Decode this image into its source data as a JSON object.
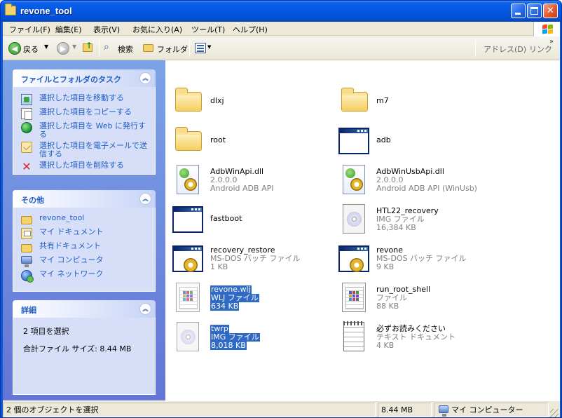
{
  "window": {
    "title": "revone_tool"
  },
  "menu": [
    "ファイル(F)",
    "編集(E)",
    "表示(V)",
    "お気に入り(A)",
    "ツール(T)",
    "ヘルプ(H)"
  ],
  "toolbar": {
    "back_label": "戻る",
    "search_label": "検索",
    "folders_label": "フォルダ",
    "address_label": "アドレス(D)",
    "links_label": "リンク",
    "more": "»"
  },
  "task_pane": {
    "file_tasks": {
      "title": "ファイルとフォルダのタスク",
      "items": [
        "選択した項目を移動する",
        "選択した項目をコピーする",
        "選択した項目を Web に発行する",
        "選択した項目を電子メールで送信する",
        "選択した項目を削除する"
      ]
    },
    "other_places": {
      "title": "その他",
      "items": [
        "revone_tool",
        "マイ ドキュメント",
        "共有ドキュメント",
        "マイ コンピュータ",
        "マイ ネットワーク"
      ]
    },
    "details": {
      "title": "詳細",
      "selected_text": "2 項目を選択",
      "total_size_text": "合計ファイル サイズ: 8.44 MB"
    }
  },
  "files": [
    {
      "name": "dlxj",
      "type": "folder"
    },
    {
      "name": "m7",
      "type": "folder"
    },
    {
      "name": "root",
      "type": "folder"
    },
    {
      "name": "adb",
      "type": "app"
    },
    {
      "name": "AdbWinApi.dll",
      "line2": "2.0.0.0",
      "line3": "Android ADB API",
      "type": "dll"
    },
    {
      "name": "AdbWinUsbApi.dll",
      "line2": "2.0.0.0",
      "line3": "Android ADB API (WinUsb)",
      "type": "dll"
    },
    {
      "name": "fastboot",
      "type": "app"
    },
    {
      "name": "HTL22_recovery",
      "line2": "IMG ファイル",
      "line3": "16,384 KB",
      "type": "disc"
    },
    {
      "name": "recovery_restore",
      "line2": "MS-DOS バッチ ファイル",
      "line3": "1 KB",
      "type": "batch"
    },
    {
      "name": "revone",
      "line2": "MS-DOS バッチ ファイル",
      "line3": "9 KB",
      "type": "batch"
    },
    {
      "name": "revone.wlj",
      "line2": "WLJ ファイル",
      "line3": "634 KB",
      "type": "grid",
      "selected": true
    },
    {
      "name": "run_root_shell",
      "line2": "ファイル",
      "line3": "88 KB",
      "type": "grid"
    },
    {
      "name": "twrp",
      "line2": "IMG ファイル",
      "line3": "8,018 KB",
      "type": "disc",
      "selected": true
    },
    {
      "name": "必ずお読みください",
      "line2": "テキスト ドキュメント",
      "line3": "4 KB",
      "type": "text"
    }
  ],
  "status": {
    "objects": "2 個のオブジェクトを選択",
    "size": "8.44 MB",
    "location": "マイ コンピューター"
  },
  "colors": {
    "selection": "#316ac5",
    "task_link": "#215dc6",
    "titlebar": "#0456e0"
  }
}
